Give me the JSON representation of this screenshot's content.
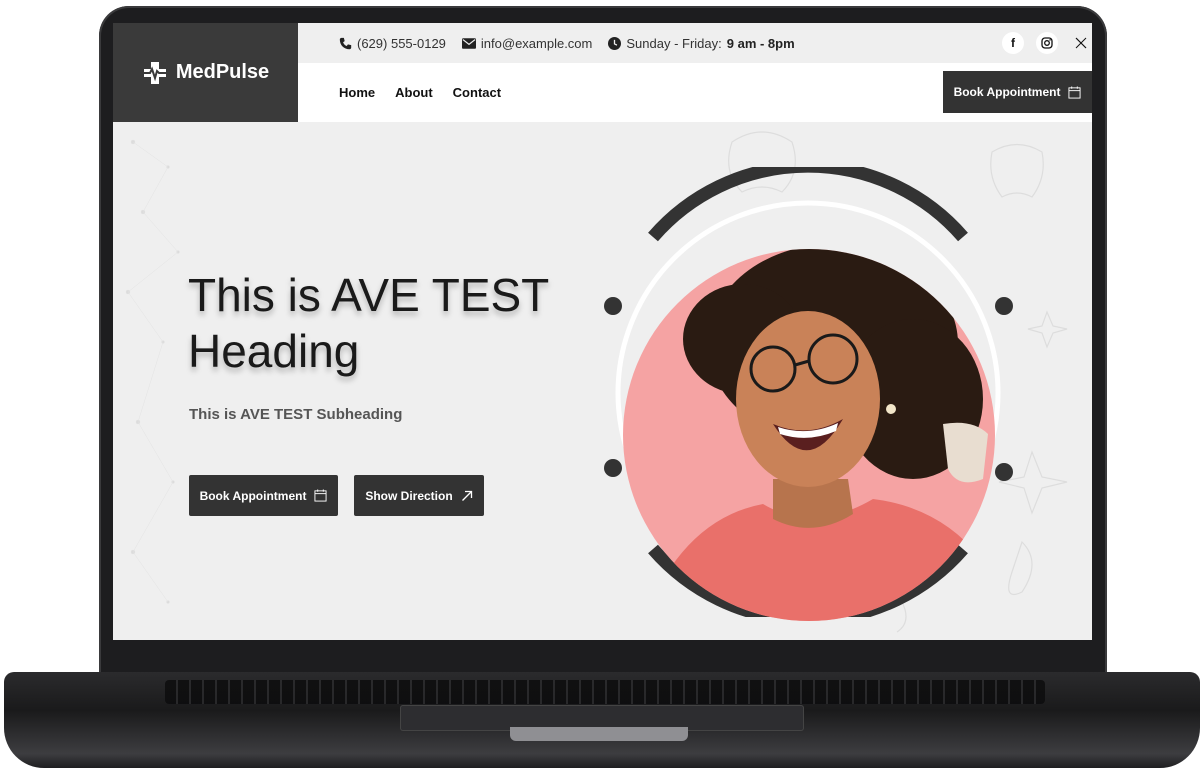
{
  "brand": {
    "name": "MedPulse"
  },
  "topbar": {
    "phone": "(629) 555-0129",
    "email": "info@example.com",
    "hours_prefix": "Sunday - Friday:",
    "hours_value": "9 am - 8pm",
    "socials": [
      "facebook",
      "instagram",
      "x"
    ]
  },
  "nav": {
    "links": [
      {
        "label": "Home"
      },
      {
        "label": "About"
      },
      {
        "label": "Contact"
      }
    ],
    "cta_label": "Book Appointment"
  },
  "hero": {
    "title": "This is AVE TEST Heading",
    "subtitle": "This is AVE TEST Subheading",
    "primary_button": "Book Appointment",
    "secondary_button": "Show Direction"
  },
  "colors": {
    "dark": "#333333",
    "hero_bg": "#efefef",
    "portrait_bg": "#f5a3a3"
  },
  "icons": [
    "phone-icon",
    "envelope-icon",
    "clock-icon",
    "calendar-icon",
    "arrow-up-right-icon",
    "medical-cross-icon"
  ]
}
